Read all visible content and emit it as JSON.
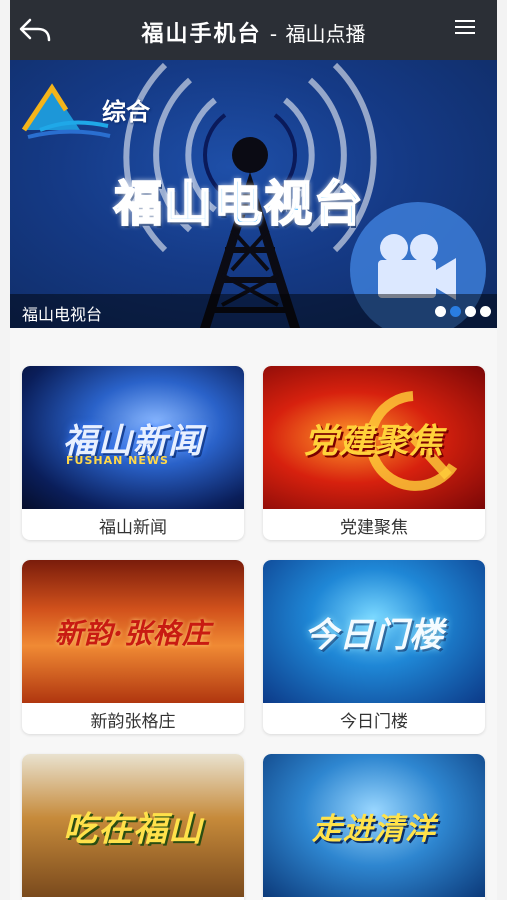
{
  "header": {
    "brand": "福山手机台",
    "separator": "-",
    "page_title": "福山点播",
    "back_icon": "back-arrow-icon",
    "menu_icon": "hamburger-menu-icon"
  },
  "banner": {
    "channel_label": "综合",
    "station_title": "福山电视台",
    "caption": "福山电视台",
    "slide_count": 4,
    "active_slide": 2,
    "accent_color": "#2a7de1"
  },
  "programs": [
    {
      "thumb_title": "福山新闻",
      "thumb_subtitle": "FUSHAN NEWS",
      "label": "福山新闻"
    },
    {
      "thumb_title": "党建聚焦",
      "label": "党建聚焦"
    },
    {
      "thumb_title": "新韵·张格庄",
      "label": "新韵张格庄"
    },
    {
      "thumb_title": "今日门楼",
      "label": "今日门楼"
    },
    {
      "thumb_title": "吃在福山",
      "label": ""
    },
    {
      "thumb_title": "走进清洋",
      "label": ""
    }
  ]
}
